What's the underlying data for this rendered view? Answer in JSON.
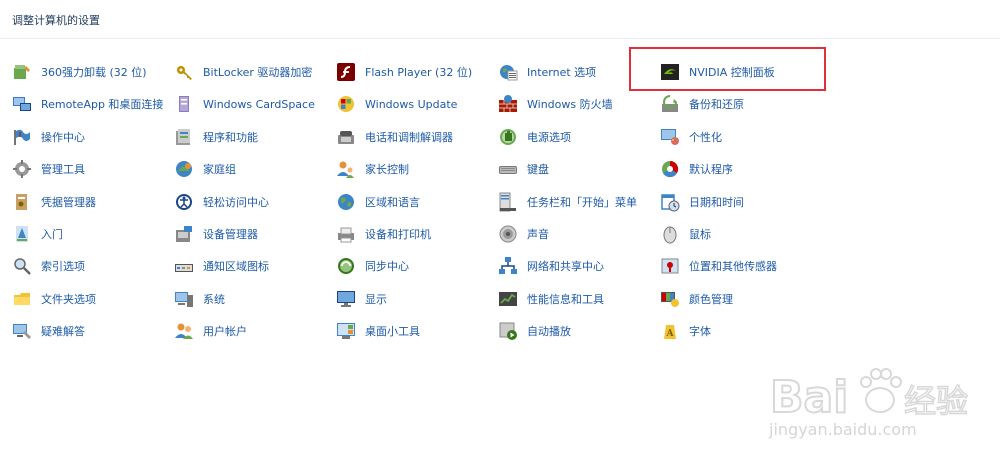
{
  "header": {
    "title": "调整计算机的设置"
  },
  "columns": [
    {
      "items": [
        {
          "label": "360强力卸载 (32 位)",
          "icon": "uninstall-icon"
        },
        {
          "label": "RemoteApp 和桌面连接",
          "icon": "remoteapp-icon"
        },
        {
          "label": "操作中心",
          "icon": "action-center-flag-icon"
        },
        {
          "label": "管理工具",
          "icon": "admin-tools-icon"
        },
        {
          "label": "凭据管理器",
          "icon": "credential-manager-icon"
        },
        {
          "label": "入门",
          "icon": "getting-started-icon"
        },
        {
          "label": "索引选项",
          "icon": "indexing-magnifier-icon"
        },
        {
          "label": "文件夹选项",
          "icon": "folder-options-icon"
        },
        {
          "label": "疑难解答",
          "icon": "troubleshooting-icon"
        }
      ]
    },
    {
      "items": [
        {
          "label": "BitLocker 驱动器加密",
          "icon": "bitlocker-key-icon"
        },
        {
          "label": "Windows CardSpace",
          "icon": "cardspace-icon"
        },
        {
          "label": "程序和功能",
          "icon": "programs-icon"
        },
        {
          "label": "家庭组",
          "icon": "homegroup-icon"
        },
        {
          "label": "轻松访问中心",
          "icon": "ease-of-access-icon"
        },
        {
          "label": "设备管理器",
          "icon": "device-manager-icon"
        },
        {
          "label": "通知区域图标",
          "icon": "notification-area-icon"
        },
        {
          "label": "系统",
          "icon": "system-icon"
        },
        {
          "label": "用户帐户",
          "icon": "user-accounts-icon"
        }
      ]
    },
    {
      "items": [
        {
          "label": "Flash Player (32 位)",
          "icon": "flash-player-icon"
        },
        {
          "label": "Windows Update",
          "icon": "windows-update-icon"
        },
        {
          "label": "电话和调制解调器",
          "icon": "phone-modem-icon"
        },
        {
          "label": "家长控制",
          "icon": "parental-controls-icon"
        },
        {
          "label": "区域和语言",
          "icon": "region-language-globe-icon"
        },
        {
          "label": "设备和打印机",
          "icon": "devices-printers-icon"
        },
        {
          "label": "同步中心",
          "icon": "sync-center-icon"
        },
        {
          "label": "显示",
          "icon": "display-monitor-icon"
        },
        {
          "label": "桌面小工具",
          "icon": "desktop-gadgets-icon"
        }
      ]
    },
    {
      "items": [
        {
          "label": "Internet 选项",
          "icon": "internet-options-icon"
        },
        {
          "label": "Windows 防火墙",
          "icon": "firewall-icon"
        },
        {
          "label": "电源选项",
          "icon": "power-options-icon"
        },
        {
          "label": "键盘",
          "icon": "keyboard-icon"
        },
        {
          "label": "任务栏和「开始」菜单",
          "icon": "taskbar-start-menu-icon"
        },
        {
          "label": "声音",
          "icon": "sound-speaker-icon"
        },
        {
          "label": "网络和共享中心",
          "icon": "network-sharing-icon"
        },
        {
          "label": "性能信息和工具",
          "icon": "performance-icon"
        },
        {
          "label": "自动播放",
          "icon": "autoplay-icon"
        }
      ]
    },
    {
      "items": [
        {
          "label": "NVIDIA 控制面板",
          "icon": "nvidia-icon"
        },
        {
          "label": "备份和还原",
          "icon": "backup-restore-icon"
        },
        {
          "label": "个性化",
          "icon": "personalization-icon"
        },
        {
          "label": "默认程序",
          "icon": "default-programs-icon"
        },
        {
          "label": "日期和时间",
          "icon": "date-time-icon"
        },
        {
          "label": "鼠标",
          "icon": "mouse-icon"
        },
        {
          "label": "位置和其他传感器",
          "icon": "location-sensors-icon"
        },
        {
          "label": "颜色管理",
          "icon": "color-management-icon"
        },
        {
          "label": "字体",
          "icon": "fonts-icon"
        }
      ]
    }
  ],
  "highlight": {
    "target": "NVIDIA 控制面板",
    "color": "#e0303a"
  },
  "watermark": {
    "brand": "Bai",
    "brand_cn": "经验",
    "url": "jingyan.baidu.com"
  },
  "colors": {
    "link": "#1e5aa8",
    "header_text": "#1e395b"
  }
}
